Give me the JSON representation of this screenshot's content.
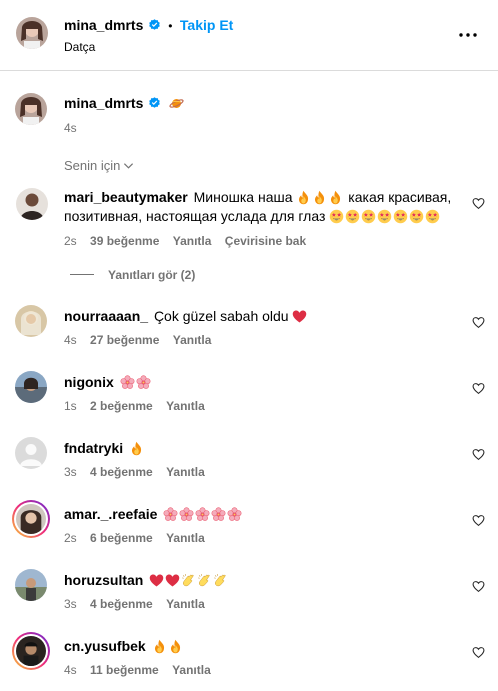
{
  "header": {
    "username": "mina_dmrts",
    "separator": "•",
    "follow_label": "Takip Et",
    "location": "Datça"
  },
  "caption": {
    "username": "mina_dmrts",
    "emoji": "planet",
    "time": "4s"
  },
  "sort": {
    "label": "Senin için"
  },
  "comments": [
    {
      "username": "mari_beautymaker",
      "text_a": "Миношка наша",
      "emoji_a": [
        "fire",
        "fire",
        "fire"
      ],
      "text_b": "какая красивая,",
      "text_c": "позитивная, настоящая услада для глаз",
      "emoji_c": [
        "star-struck",
        "star-struck",
        "star-struck",
        "star-struck",
        "star-struck",
        "star-struck",
        "star-struck"
      ],
      "time": "2s",
      "likes": "39 beğenme",
      "reply": "Yanıtla",
      "translate": "Çevirisine bak",
      "view_replies": "Yanıtları gör (2)"
    },
    {
      "username": "nourraaaan_",
      "text": "Çok güzel sabah oldu",
      "emoji": [
        "red-heart"
      ],
      "time": "4s",
      "likes": "27 beğenme",
      "reply": "Yanıtla"
    },
    {
      "username": "nigonix",
      "text": "",
      "emoji": [
        "cherry-blossom",
        "cherry-blossom"
      ],
      "time": "1s",
      "likes": "2 beğenme",
      "reply": "Yanıtla"
    },
    {
      "username": "fndatryki",
      "text": "",
      "emoji": [
        "fire"
      ],
      "time": "3s",
      "likes": "4 beğenme",
      "reply": "Yanıtla"
    },
    {
      "username": "amar._.reefaie",
      "text": "",
      "emoji": [
        "cherry-blossom",
        "cherry-blossom",
        "cherry-blossom",
        "cherry-blossom",
        "cherry-blossom"
      ],
      "time": "2s",
      "likes": "6 beğenme",
      "reply": "Yanıtla"
    },
    {
      "username": "horuzsultan",
      "text": "",
      "emoji": [
        "red-heart",
        "red-heart",
        "clapping-hands",
        "clapping-hands",
        "clapping-hands"
      ],
      "time": "3s",
      "likes": "4 beğenme",
      "reply": "Yanıtla"
    },
    {
      "username": "cn.yusufbek",
      "text": "",
      "emoji": [
        "fire",
        "fire"
      ],
      "time": "4s",
      "likes": "11 beğenme",
      "reply": "Yanıtla"
    }
  ],
  "colors": {
    "link": "#0095f6",
    "muted": "#737373",
    "border": "#dbdbdb",
    "verified": "#0095f6"
  }
}
